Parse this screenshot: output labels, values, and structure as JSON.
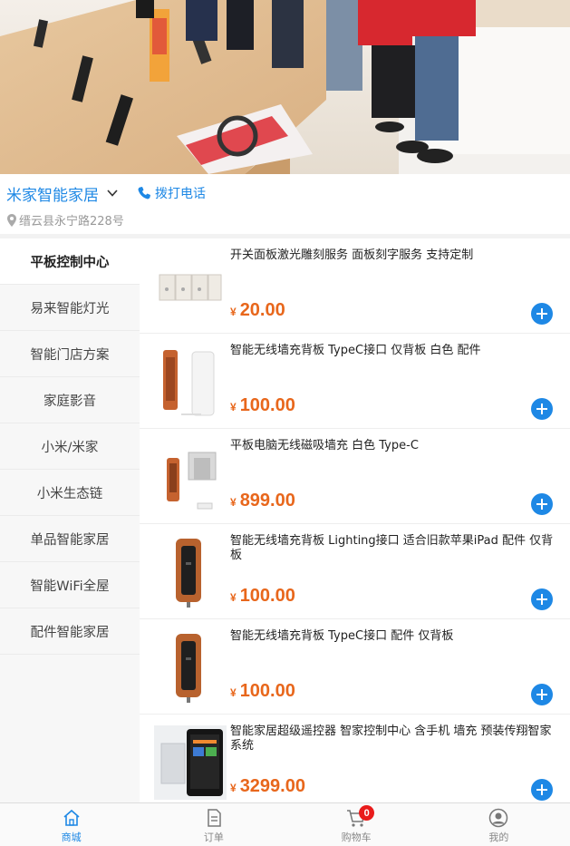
{
  "store": {
    "name": "米家智能家居",
    "call_label": "拨打电话",
    "address": "缙云县永宁路228号"
  },
  "categories": [
    {
      "label": "平板控制中心",
      "active": true
    },
    {
      "label": "易来智能灯光"
    },
    {
      "label": "智能门店方案"
    },
    {
      "label": "家庭影音"
    },
    {
      "label": "小米/米家"
    },
    {
      "label": "小米生态链"
    },
    {
      "label": "单品智能家居"
    },
    {
      "label": "智能WiFi全屋"
    },
    {
      "label": "配件智能家居"
    }
  ],
  "currency": "¥",
  "products": [
    {
      "title": "开关面板激光雕刻服务 面板刻字服务 支持定制",
      "price": "20.00"
    },
    {
      "title": "智能无线墙充背板 TypeC接口 仅背板 白色 配件",
      "price": "100.00"
    },
    {
      "title": "平板电脑无线磁吸墙充 白色 Type-C",
      "price": "899.00"
    },
    {
      "title": "智能无线墙充背板 Lighting接口 适合旧款苹果iPad 配件 仅背板",
      "price": "100.00"
    },
    {
      "title": "智能无线墙充背板 TypeC接口 配件 仅背板",
      "price": "100.00"
    },
    {
      "title": "智能家居超级遥控器 智家控制中心 含手机 墙充 预装传翔智家系统",
      "price": "3299.00"
    }
  ],
  "tabbar": {
    "items": [
      {
        "label": "商城",
        "icon": "home-icon",
        "active": true
      },
      {
        "label": "订单",
        "icon": "order-icon"
      },
      {
        "label": "购物车",
        "icon": "cart-icon",
        "badge": "0"
      },
      {
        "label": "我的",
        "icon": "profile-icon"
      }
    ]
  },
  "colors": {
    "accent": "#1e88e5",
    "price": "#e8671c",
    "badge": "#e91c1c"
  }
}
